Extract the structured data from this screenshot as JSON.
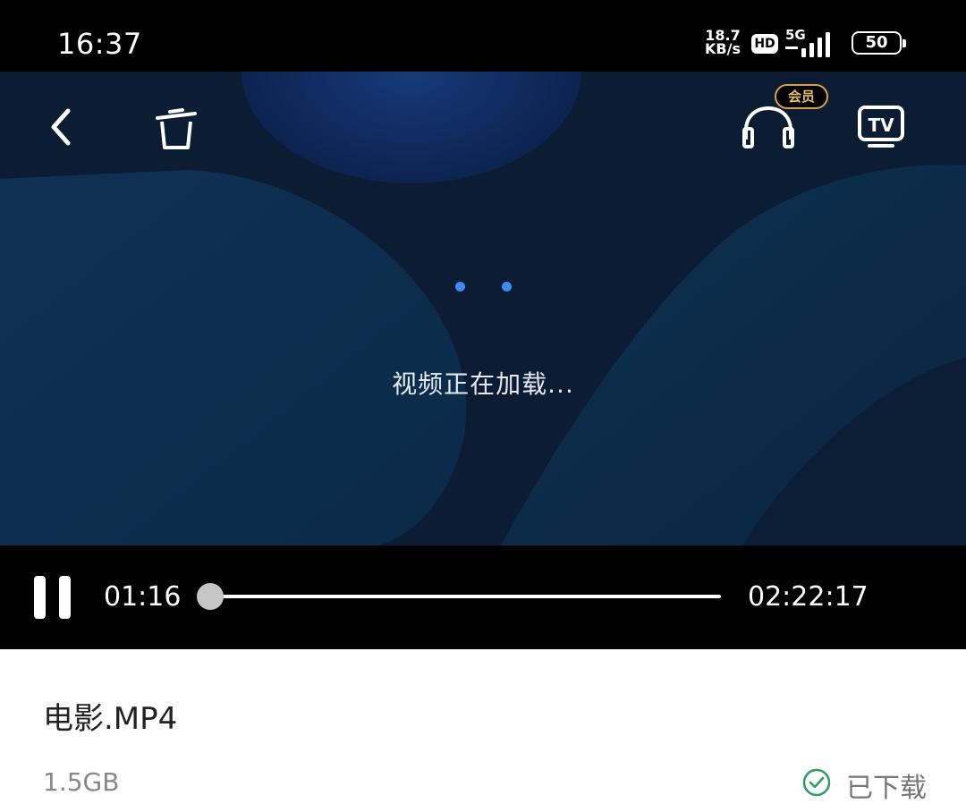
{
  "status_bar": {
    "time": "16:37",
    "net_speed_value": "18.7",
    "net_speed_unit": "KB/s",
    "hd_label": "HD",
    "network_label": "5G",
    "battery": "50"
  },
  "player": {
    "vip_label": "会员",
    "tv_label": "TV",
    "loading_text": "视频正在加载...",
    "current_time": "01:16",
    "total_time": "02:22:17",
    "progress_fraction": 0.009
  },
  "file": {
    "name": "电影.MP4",
    "size": "1.5GB",
    "status": "已下载"
  },
  "colors": {
    "accent_blue": "#3d8cf2",
    "vip_gold": "#d6a152",
    "downloaded_green": "#2aa15b"
  }
}
